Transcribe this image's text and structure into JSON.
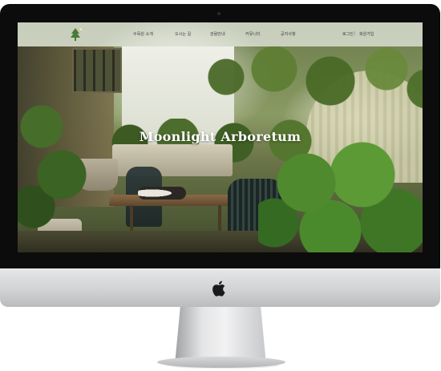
{
  "site": {
    "hero_title": "Moonlight Arboretum",
    "logo_icon": "pine-tree-moon-icon",
    "colors": {
      "nav_background": "#ffffffa0",
      "nav_text": "#3b3b3b",
      "hero_text": "#ffffff",
      "logo_green": "#4a7a3a"
    }
  },
  "navbar": {
    "items": [
      {
        "label": "수목원 소개"
      },
      {
        "label": "오시는 길"
      },
      {
        "label": "관람안내"
      },
      {
        "label": "커뮤니티"
      },
      {
        "label": "공지사항"
      }
    ],
    "login_label": "로그인",
    "separator": "|",
    "signup_label": "회원가입"
  },
  "device": {
    "brand_icon": "apple-logo-icon"
  }
}
